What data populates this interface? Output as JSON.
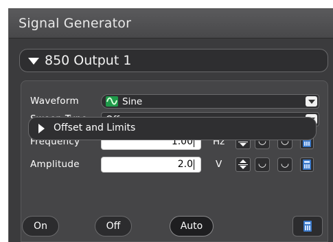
{
  "window": {
    "title": "Signal Generator"
  },
  "output_section": {
    "label": "850 Output 1",
    "expanded": true
  },
  "waveform": {
    "label": "Waveform",
    "value": "Sine",
    "icon": "sine-wave-icon"
  },
  "sweep_type": {
    "label": "Sweep Type",
    "value": "Off"
  },
  "frequency": {
    "label": "Frequency",
    "value": "1.00",
    "unit": "Hz"
  },
  "amplitude": {
    "label": "Amplitude",
    "value": "2.0",
    "unit": "V"
  },
  "offset_section": {
    "label": "Offset and Limits",
    "expanded": false
  },
  "buttons": {
    "on": "On",
    "off": "Off",
    "auto": "Auto"
  },
  "colors": {
    "panel_bg": "#3b3b3d",
    "accent_green": "#1f9a4a",
    "calc_blue": "#3a78c8"
  }
}
